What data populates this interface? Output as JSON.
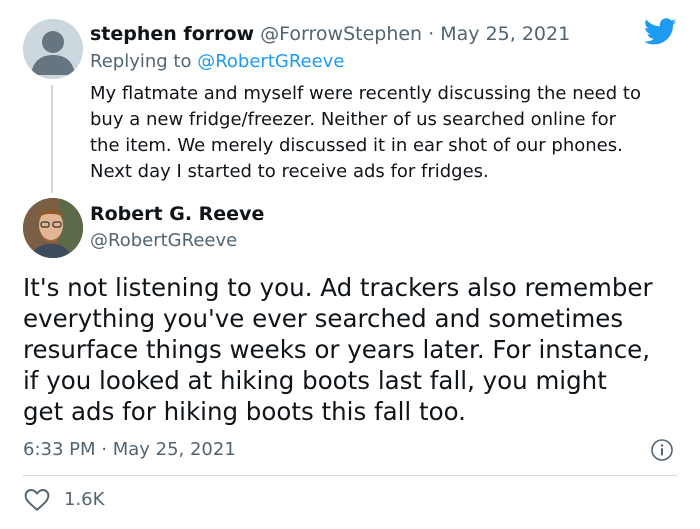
{
  "reply_tweet": {
    "author_name": "stephen forrow",
    "author_handle": "@ForrowStephen",
    "separator": "·",
    "date": "May 25, 2021",
    "replying_label": "Replying to",
    "replying_handle": "@RobertGReeve",
    "text": "My flatmate and myself were recently discussing the need to\nbuy a new fridge/freezer. Neither of us searched online for\nthe item. We merely discussed it in ear shot of our phones.\nNext day  I started to receive ads for fridges."
  },
  "main_tweet": {
    "author_name": "Robert G. Reeve",
    "author_handle": "@RobertGReeve",
    "text": "It's not listening to you. Ad trackers also remember\neverything you've ever searched and sometimes\nresurface things weeks or years later. For instance,\nif you looked at hiking boots last fall, you might\nget ads for hiking boots this fall too.",
    "timestamp": "6:33 PM · May 25, 2021",
    "likes": "1.6K"
  },
  "colors": {
    "brand": "#1d9bf0",
    "text": "#0f1419",
    "muted": "#536471",
    "divider": "#cfd9de"
  },
  "icons": [
    "twitter-bird-icon",
    "info-icon",
    "heart-icon",
    "default-avatar-icon"
  ]
}
